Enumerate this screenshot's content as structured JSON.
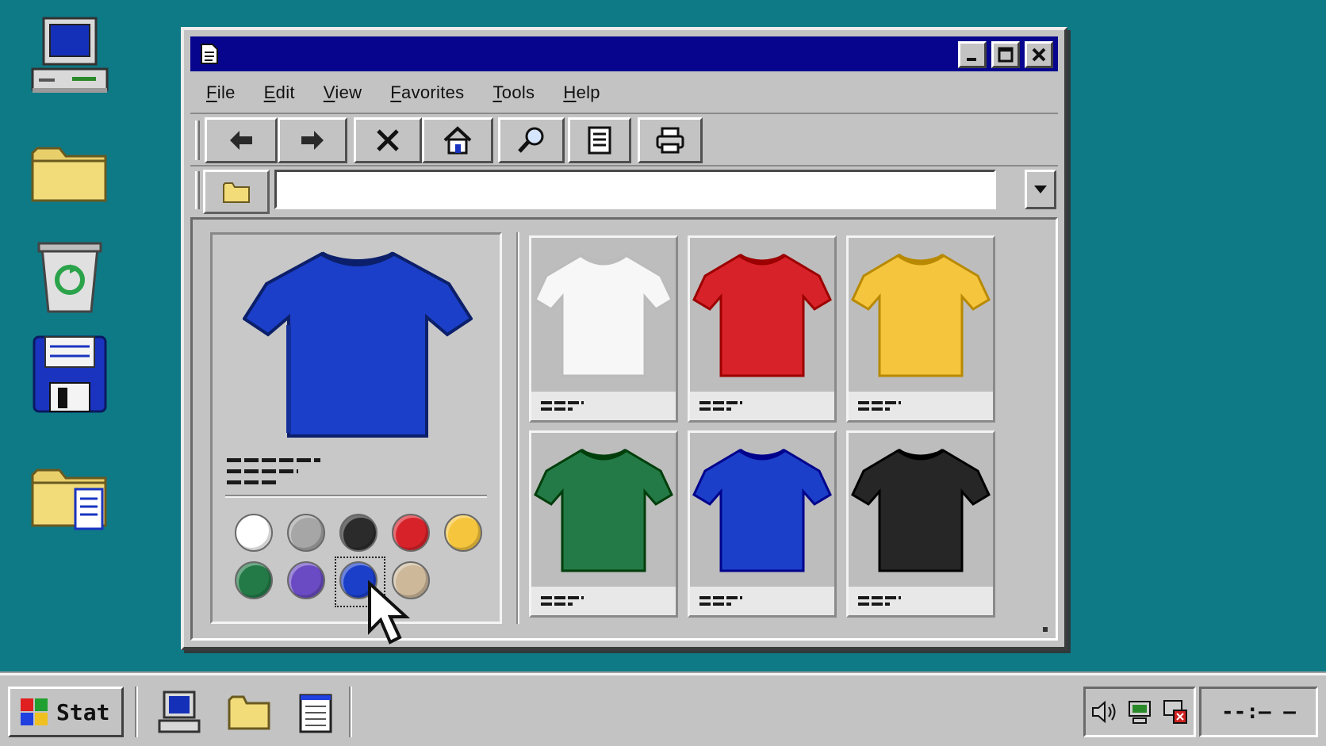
{
  "desktop": {
    "icons": [
      {
        "name": "my-computer-icon"
      },
      {
        "name": "folder-icon"
      },
      {
        "name": "recycle-bin-icon"
      },
      {
        "name": "floppy-disk-icon"
      },
      {
        "name": "documents-folder-icon"
      }
    ]
  },
  "window": {
    "title": "",
    "controls": [
      "minimize",
      "maximize",
      "close"
    ],
    "menu": [
      {
        "label": "File"
      },
      {
        "label": "Edit"
      },
      {
        "label": "View"
      },
      {
        "label": "Favorites"
      },
      {
        "label": "Tools"
      },
      {
        "label": "Help"
      }
    ],
    "toolbar": [
      "back-icon",
      "forward-icon",
      "stop-icon",
      "home-icon",
      "search-icon",
      "history-icon",
      "print-icon"
    ],
    "address": {
      "value": "",
      "placeholder": ""
    }
  },
  "product": {
    "preview_color": "#1b3fc8",
    "swatches": [
      {
        "color": "#ffffff",
        "selected": false
      },
      {
        "color": "#a6a6a6",
        "selected": false
      },
      {
        "color": "#2b2b2b",
        "selected": false
      },
      {
        "color": "#d8222a",
        "selected": false
      },
      {
        "color": "#f4c53d",
        "selected": false
      },
      {
        "color": "#237a47",
        "selected": false
      },
      {
        "color": "#6a4bc3",
        "selected": false
      },
      {
        "color": "#1b3fc8",
        "selected": true
      },
      {
        "color": "#cdb89a",
        "selected": false
      }
    ],
    "grid": [
      {
        "color": "#f7f7f7"
      },
      {
        "color": "#d8222a"
      },
      {
        "color": "#f4c53d"
      },
      {
        "color": "#237a47"
      },
      {
        "color": "#1b3fc8"
      },
      {
        "color": "#262626"
      }
    ]
  },
  "taskbar": {
    "start_label": "Stat",
    "clock": "--:– –",
    "tray": [
      "speaker-icon",
      "network-icon",
      "alert-icon"
    ]
  },
  "colors": {
    "desktop": "#0e7a86",
    "titlebar": "#07058e",
    "chrome": "#c3c3c3"
  }
}
